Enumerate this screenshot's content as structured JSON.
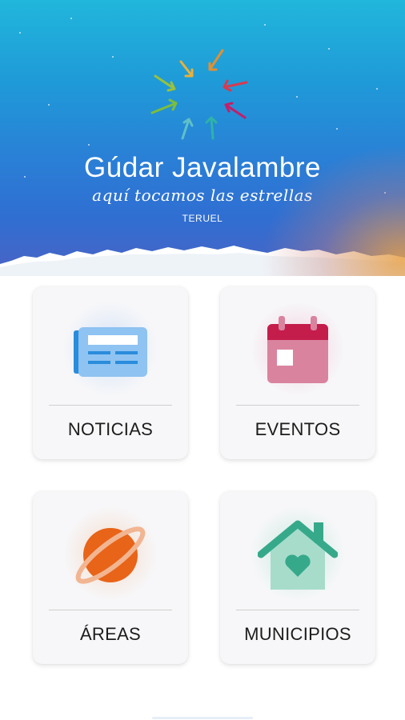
{
  "header": {
    "brand": "Gúdar Javalambre",
    "tagline": "aquí tocamos las estrellas",
    "region": "TERUEL",
    "logo_icon": "star-arrows-logo-icon",
    "colors": {
      "sky_top": "#21b6db",
      "sky_bottom": "#2f6fd2"
    }
  },
  "menu": [
    {
      "label": "NOTICIAS",
      "icon": "newspaper-icon",
      "color": "#2a8cdc"
    },
    {
      "label": "EVENTOS",
      "icon": "calendar-icon",
      "color": "#c41d4b"
    },
    {
      "label": "ÁREAS",
      "icon": "planet-icon",
      "color": "#e86418"
    },
    {
      "label": "MUNICIPIOS",
      "icon": "house-heart-icon",
      "color": "#36a98b"
    }
  ]
}
